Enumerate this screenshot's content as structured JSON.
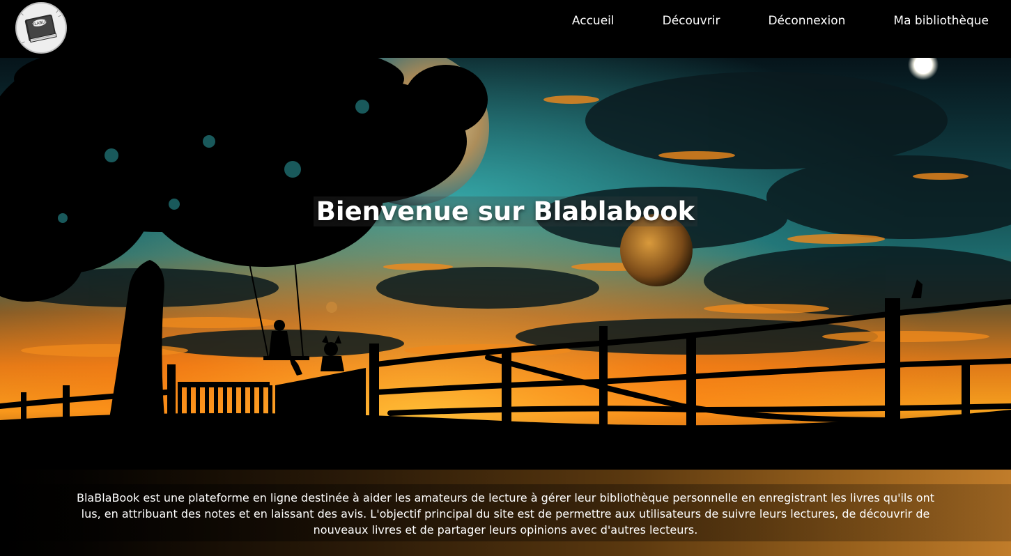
{
  "header": {
    "logo_icon": "book-logo-icon",
    "logo_text": "BLABLA",
    "nav": [
      {
        "label": "Accueil"
      },
      {
        "label": "Découvrir"
      },
      {
        "label": "Déconnexion"
      },
      {
        "label": "Ma bibliothèque"
      }
    ]
  },
  "hero": {
    "title": "Bienvenue sur Blablabook",
    "image": "night-sky-planets-tree-swing-fence-silhouette"
  },
  "description": {
    "text": "BlaBlaBook est une plateforme en ligne destinée à aider les amateurs de lecture à gérer leur bibliothèque personnelle en enregistrant les livres qu'ils ont lus, en attribuant des notes et en laissant des avis. L'objectif principal du site est de permettre aux utilisateurs de suivre leurs lectures, de découvrir de nouveaux livres et de partager leurs opinions avec d'autres lecteurs."
  },
  "colors": {
    "background": "#000000",
    "text": "#ffffff",
    "accent_orange": "#c07c2a",
    "sky_teal": "#2a8c8c"
  }
}
